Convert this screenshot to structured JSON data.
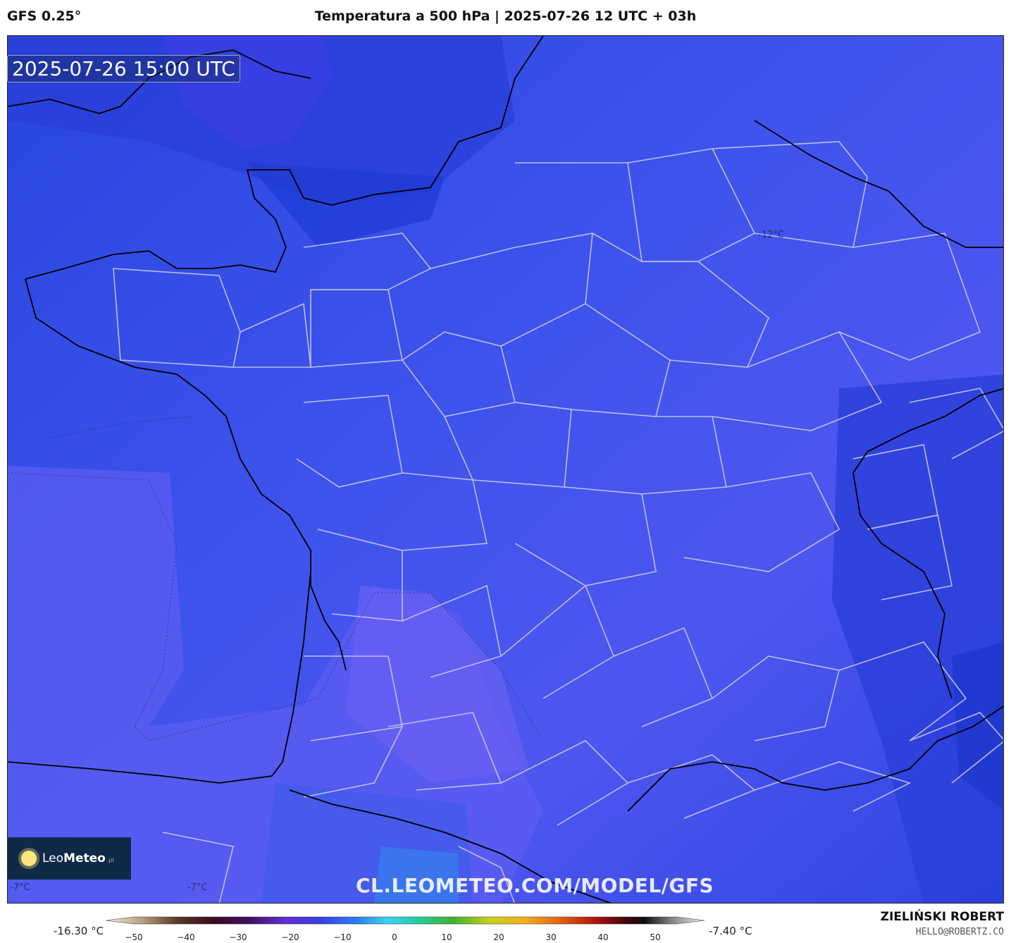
{
  "header": {
    "model": "GFS 0.25°",
    "title": "Temperatura a 500 hPa | 2025-07-26 12 UTC + 03h"
  },
  "map": {
    "valid_time": "2025-07-26 15:00 UTC",
    "watermark": "CL.LEOMETEO.COM/MODEL/GFS",
    "isotherm_labels": [
      "-12°C",
      "-7°C",
      "-7°C"
    ]
  },
  "logo": {
    "name_light": "Leo",
    "name_bold": "Meteo",
    "suffix": ".pl"
  },
  "legend": {
    "min_label": "-16.30 °C",
    "max_label": "-7.40 °C",
    "ticks": [
      "−50",
      "−40",
      "−30",
      "−20",
      "−10",
      "0",
      "10",
      "20",
      "30",
      "40",
      "50"
    ]
  },
  "credits": {
    "author": "ZIELIŃSKI ROBERT",
    "email": "HELLO@ROBERTZ.CO"
  },
  "colors": {
    "cold": "#1f3fd6",
    "mid": "#3a52e8",
    "warm": "#6a5cf0",
    "region_borders": "#c9c9e6",
    "coastline": "#000000"
  }
}
